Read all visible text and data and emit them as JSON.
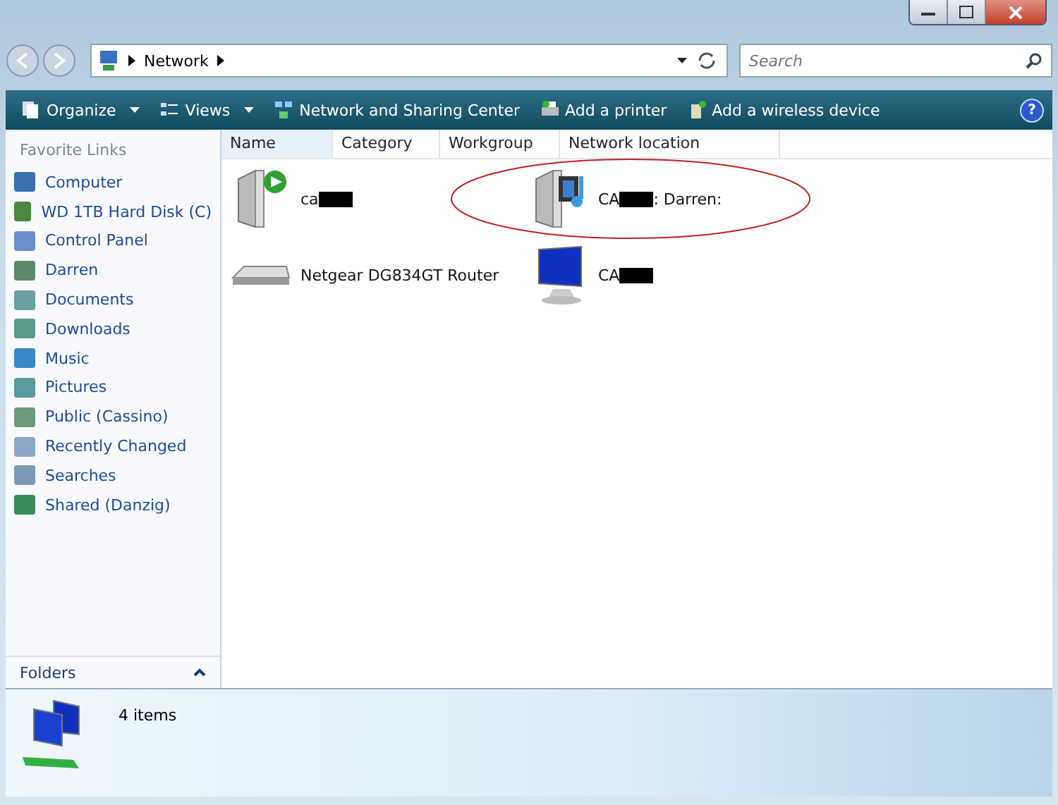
{
  "address_bar": {
    "crumbs": [
      "Network"
    ]
  },
  "search": {
    "placeholder": "Search"
  },
  "help_button": "?",
  "toolbar": [
    {
      "kind": "organize",
      "label": "Organize",
      "dropdown": true
    },
    {
      "kind": "views",
      "label": "Views",
      "dropdown": true
    },
    {
      "kind": "network",
      "label": "Network and Sharing Center",
      "dropdown": false
    },
    {
      "kind": "printer",
      "label": "Add a printer",
      "dropdown": false
    },
    {
      "kind": "wireless",
      "label": "Add a wireless device",
      "dropdown": false
    }
  ],
  "sidebar": {
    "title": "Favorite Links",
    "items": [
      {
        "kind": "computer",
        "label": "Computer"
      },
      {
        "kind": "disk",
        "label": "WD 1TB Hard Disk (C)"
      },
      {
        "kind": "control",
        "label": "Control Panel"
      },
      {
        "kind": "user",
        "label": "Darren"
      },
      {
        "kind": "documents",
        "label": "Documents"
      },
      {
        "kind": "downloads",
        "label": "Downloads"
      },
      {
        "kind": "music",
        "label": "Music"
      },
      {
        "kind": "pictures",
        "label": "Pictures"
      },
      {
        "kind": "public",
        "label": "Public (Cassino)"
      },
      {
        "kind": "recent",
        "label": "Recently Changed"
      },
      {
        "kind": "searches",
        "label": "Searches"
      },
      {
        "kind": "shared",
        "label": "Shared (Danzig)"
      }
    ],
    "folders_label": "Folders"
  },
  "columns": [
    {
      "label": "Name",
      "sorted": true
    },
    {
      "label": "Category",
      "sorted": false
    },
    {
      "label": "Workgroup",
      "sorted": false
    },
    {
      "label": "Network location",
      "sorted": false
    }
  ],
  "items": [
    {
      "kind": "player",
      "label_before": "ca",
      "redacted": true,
      "circled": false
    },
    {
      "kind": "media",
      "label_before": "CA",
      "redacted": true,
      "label_after": ": Darren:",
      "circled": true
    },
    {
      "kind": "router",
      "label_before": "Netgear DG834GT Router",
      "redacted": false,
      "circled": false
    },
    {
      "kind": "computer",
      "label_before": "CA",
      "redacted": true,
      "circled": false
    }
  ],
  "status_bar": {
    "count": "4 items"
  }
}
